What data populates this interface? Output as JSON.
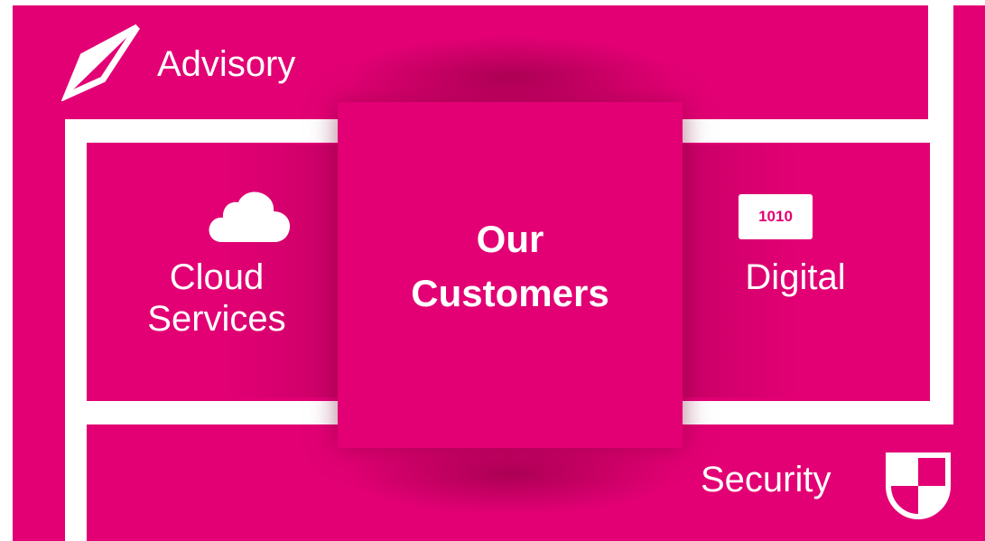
{
  "brand": {
    "magenta": "#e20074",
    "white": "#ffffff"
  },
  "diagram": {
    "center": {
      "line1": "Our",
      "line2": "Customers"
    },
    "advisory": {
      "label": "Advisory",
      "icon": "compass-icon"
    },
    "cloud": {
      "line1": "Cloud",
      "line2": "Services",
      "icon": "cloud-icon"
    },
    "digital": {
      "label": "Digital",
      "icon": "binary-icon",
      "icon_text": "1010"
    },
    "security": {
      "label": "Security",
      "icon": "shield-icon"
    }
  }
}
